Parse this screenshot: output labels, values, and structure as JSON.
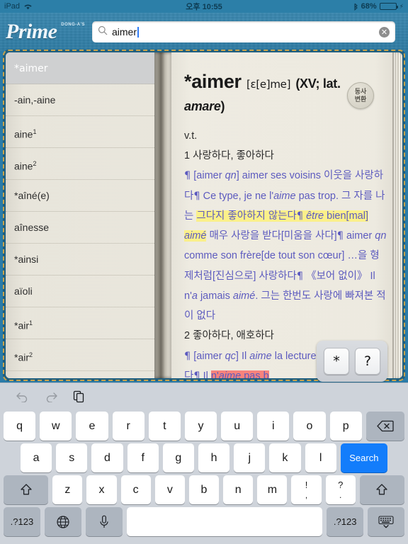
{
  "status_bar": {
    "device": "iPad",
    "wifi_icon": "wifi-icon",
    "time": "오후 10:55",
    "bluetooth_icon": "bluetooth-icon",
    "battery_percent": "68%",
    "battery_level": 68,
    "charging_icon": "charging-bolt-icon"
  },
  "top_bar": {
    "logo_main": "Prime",
    "logo_sub": "DONG-A'S",
    "search": {
      "icon": "search-icon",
      "value": "aimer",
      "placeholder": "",
      "clear_icon": "clear-circle-icon",
      "clear_glyph": "✕"
    }
  },
  "sidebar": {
    "items": [
      {
        "label": "*aimer",
        "selected": true
      },
      {
        "label": "-ain,-aine",
        "selected": false
      },
      {
        "label": "aine",
        "sup": "1",
        "selected": false
      },
      {
        "label": "aine",
        "sup": "2",
        "selected": false
      },
      {
        "label": "*aîné(e)",
        "selected": false
      },
      {
        "label": "aînesse",
        "selected": false
      },
      {
        "label": "*ainsi",
        "selected": false
      },
      {
        "label": "aïoli",
        "selected": false
      },
      {
        "label": "*air",
        "sup": "1",
        "selected": false
      },
      {
        "label": "*air",
        "sup": "2",
        "selected": false
      }
    ]
  },
  "entry": {
    "headword": "*aimer",
    "pronunciation": "[ɛ[e]me]",
    "etymology_open": "(XV;",
    "etymology_rest": "lat. ",
    "etymology_italic": "amare",
    "etymology_close": ")",
    "conjugation_button": {
      "line1": "동사",
      "line2": "변환"
    },
    "part_of_speech": "v.t.",
    "senses": [
      {
        "number": "1",
        "gloss": "사랑하다, 좋아하다",
        "examples_text": "¶ [aimer qn] aimer ses voisins 이웃을 사랑하다¶ Ce type, je ne l'aime pas trop. 그 자를 나는 그다지 좋아하지 않는다¶ être bien[mal] aimé 매우 사랑을 받다[미움을 사다]¶ aimer qn comme son frère[de tout son cœur] …을 형제처럼[진심으로] 사랑하다¶ 《보어 없이》 Il n'a jamais aimé. 그는 한번도 사랑에 빠져본 적이 없다"
      },
      {
        "number": "2",
        "gloss": "좋아하다, 애호하다",
        "examples_text": "¶ [aimer qc] Il aime la lecture 독서를 좋아한다¶ Il n'aime pas b"
      }
    ],
    "highlight_yellow_text": "그다지 좋아하지 않는다¶ être bien[mal] aimé",
    "highlight_pink_text": "n'aime pas b"
  },
  "popup": {
    "keys": [
      {
        "label": "*",
        "name": "asterisk-key"
      },
      {
        "label": "?",
        "name": "question-mark-key"
      }
    ]
  },
  "keyboard": {
    "toolbar": [
      {
        "name": "undo-icon",
        "enabled": false
      },
      {
        "name": "redo-icon",
        "enabled": false
      },
      {
        "name": "paste-icon",
        "enabled": true
      }
    ],
    "row1": [
      "q",
      "w",
      "e",
      "r",
      "t",
      "y",
      "u",
      "i",
      "o",
      "p"
    ],
    "backspace": "⌫",
    "row2": [
      "a",
      "s",
      "d",
      "f",
      "g",
      "h",
      "j",
      "k",
      "l"
    ],
    "search_key": "Search",
    "row3": [
      "z",
      "x",
      "c",
      "v",
      "b",
      "n",
      "m"
    ],
    "punct_key_1": {
      "top": "!",
      "bottom": ","
    },
    "punct_key_2": {
      "top": "?",
      "bottom": "."
    },
    "shift_left": "⇧",
    "shift_right": "⇧",
    "row4": {
      "numeric_left": ".?123",
      "globe": "globe-icon",
      "mic": "mic-icon",
      "space": "",
      "numeric_right": ".?123",
      "dismiss": "hide-keyboard-icon"
    }
  },
  "colors": {
    "accent_blue": "#137dfb",
    "leather_blue": "#2f7ba3",
    "highlight_yellow": "#fbf08a",
    "highlight_pink": "#f6837c",
    "example_text": "#5d5bbf",
    "frame_gold": "#c8a24a"
  }
}
